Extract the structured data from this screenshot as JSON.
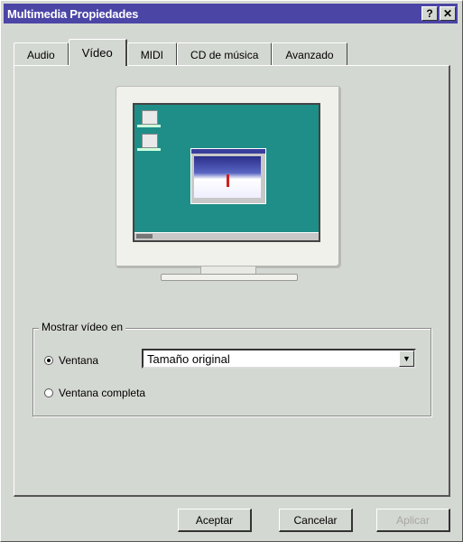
{
  "window": {
    "title": "Multimedia Propiedades",
    "help_label": "?",
    "close_label": "✕"
  },
  "tabs": [
    {
      "label": "Audio"
    },
    {
      "label": "Vídeo",
      "active": true
    },
    {
      "label": "MIDI"
    },
    {
      "label": "CD de música"
    },
    {
      "label": "Avanzado"
    }
  ],
  "display_group": {
    "label": "Mostrar vídeo en",
    "options": [
      {
        "label": "Ventana",
        "selected": true
      },
      {
        "label": "Ventana completa",
        "selected": false
      }
    ],
    "size_select": {
      "value": "Tamaño original"
    }
  },
  "buttons": {
    "ok": "Aceptar",
    "cancel": "Cancelar",
    "apply": "Aplicar"
  },
  "colors": {
    "titlebar": "#4b45a6",
    "desktop": "#1f8e88"
  }
}
